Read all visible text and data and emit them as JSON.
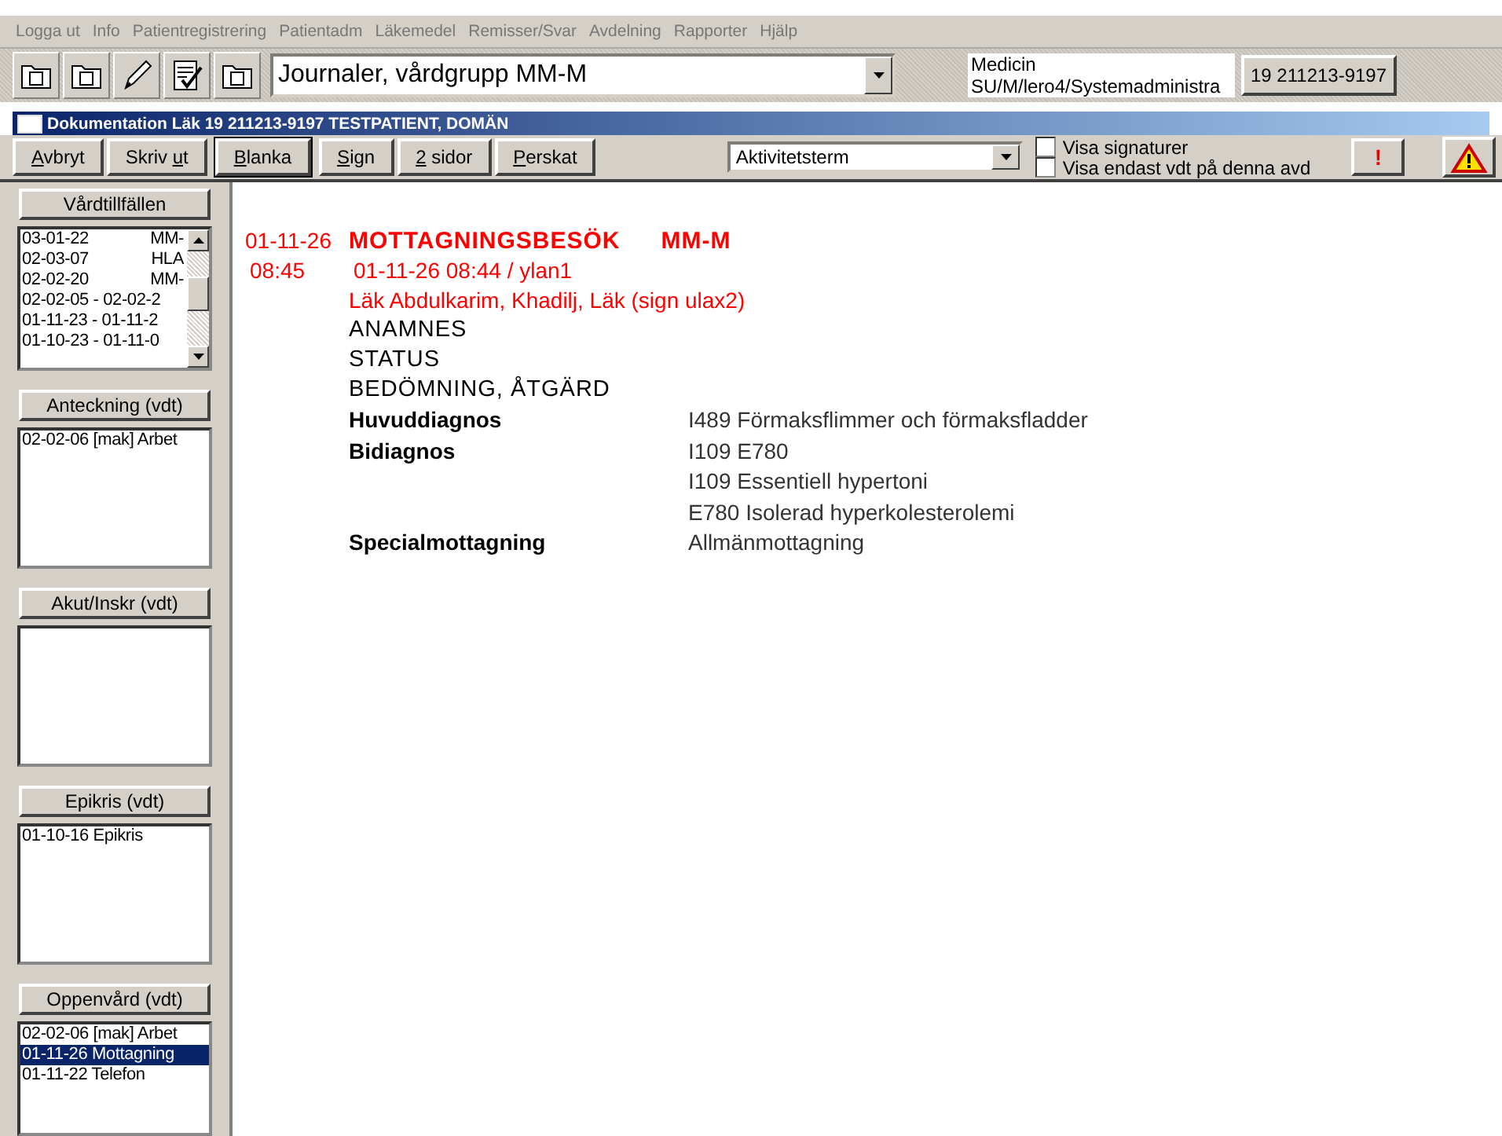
{
  "menu": [
    "Logga ut",
    "Info",
    "Patientregistrering",
    "Patientadm",
    "Läkemedel",
    "Remisser/Svar",
    "Avdelning",
    "Rapporter",
    "Hjälp"
  ],
  "toolbar": {
    "view_combo": "Journaler, vårdgrupp MM-M",
    "unit_lines": [
      "Medicin",
      "SU/M/lero4/Systemadministra"
    ],
    "patient_button": "19 211213-9197"
  },
  "window": {
    "title": "Dokumentation Läk 19 211213-9197 TESTPATIENT, DOMÄN"
  },
  "buttons": [
    {
      "key": "A",
      "rest": "vbryt",
      "default": false
    },
    {
      "pre": "Skriv ",
      "key": "u",
      "rest": "t",
      "default": false
    },
    {
      "key": "B",
      "rest": "lanka",
      "default": true
    },
    {
      "key": "S",
      "rest": "ign",
      "default": false
    },
    {
      "key": "2",
      "rest": " sidor",
      "default": false
    },
    {
      "key": "P",
      "rest": "erskat",
      "default": false
    }
  ],
  "term_combo": "Aktivitetsterm",
  "checkboxes": [
    {
      "label": "Visa signaturer",
      "checked": false
    },
    {
      "label": "Visa endast vdt på denna avd",
      "checked": false
    }
  ],
  "alert_button": "!",
  "sidebar": [
    {
      "header": "Vårdtillfällen",
      "scroll": true,
      "items": [
        {
          "date": "03-01-22",
          "code": "MM-",
          "selected": false
        },
        {
          "date": "02-03-07",
          "code": "HLA",
          "selected": false
        },
        {
          "date": "02-02-20",
          "code": "MM-",
          "selected": false
        },
        {
          "date": "02-02-05 - 02-02-2",
          "selected": false
        },
        {
          "date": "01-11-23 - 01-11-2",
          "selected": false
        },
        {
          "date": "01-10-23 - 01-11-0",
          "selected": false
        }
      ]
    },
    {
      "header": "Anteckning (vdt)",
      "scroll": false,
      "items": [
        {
          "date": "02-02-06 [mak] Arbet",
          "selected": false
        }
      ]
    },
    {
      "header": "Akut/Inskr (vdt)",
      "scroll": false
    },
    {
      "header": "Epikris (vdt)",
      "scroll": false,
      "items": [
        {
          "date": "01-10-16  Epikris",
          "selected": false
        }
      ]
    },
    {
      "header": "Oppenvård (vdt)",
      "scroll": false,
      "items": [
        {
          "date": "02-02-06 [mak] Arbet",
          "selected": false
        },
        {
          "date": "01-11-26  Mottagning",
          "selected": true
        },
        {
          "date": "01-11-22  Telefon",
          "selected": false
        }
      ]
    }
  ],
  "entry": {
    "date": "01-11-26",
    "time": "08:45",
    "title": "MOTTAGNINGSBESÖK",
    "unit": "MM-M",
    "created": "01-11-26 08:44 / ylan1",
    "author": "Läk Abdulkarim, Khadilj, Läk (sign ulax2)",
    "headings": [
      "ANAMNES",
      "STATUS",
      "BEDÖMNING, ÅTGÄRD"
    ],
    "fields": [
      {
        "label": "Huvuddiagnos",
        "values": [
          "I489 Förmaksflimmer och förmaksfladder"
        ]
      },
      {
        "label": "Bidiagnos",
        "values": [
          "I109 E780",
          "I109 Essentiell hypertoni",
          "E780 Isolerad hyperkolesterolemi"
        ]
      },
      {
        "label": "Specialmottagning",
        "values": [
          "Allmänmottagning"
        ]
      }
    ]
  }
}
